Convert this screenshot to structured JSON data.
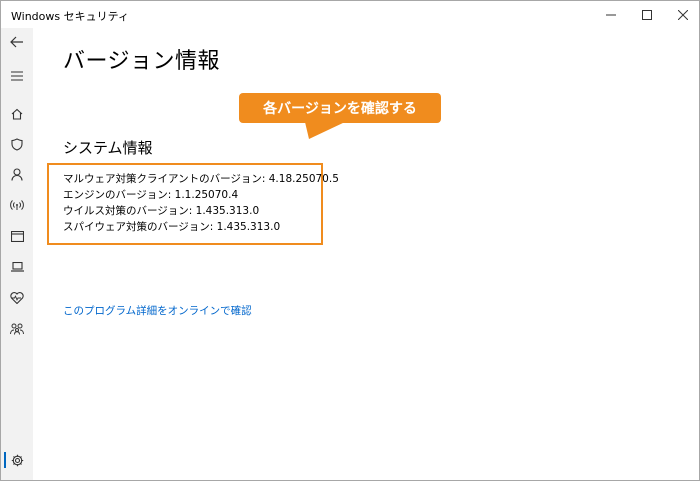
{
  "window": {
    "title": "Windows セキュリティ"
  },
  "page": {
    "title": "バージョン情報",
    "section_title": "システム情報",
    "info_lines": [
      "マルウェア対策クライアントのバージョン: 4.18.25070.5",
      "エンジンのバージョン: 1.1.25070.4",
      "ウイルス対策のバージョン: 1.435.313.0",
      "スパイウェア対策のバージョン: 1.435.313.0"
    ],
    "link": "このプログラム詳細をオンラインで確認"
  },
  "callout": {
    "text": "各バージョンを確認する"
  },
  "sidebar": {
    "items": [
      "back-icon",
      "menu-icon",
      "home-icon",
      "shield-icon",
      "person-icon",
      "wireless-icon",
      "browser-icon",
      "laptop-icon",
      "heart-icon",
      "family-icon",
      "settings-icon"
    ]
  },
  "colors": {
    "accent": "#f08c1e",
    "link": "#0066cc",
    "sidebar_bg": "#f2f2f2",
    "active_indicator": "#0067c0"
  }
}
